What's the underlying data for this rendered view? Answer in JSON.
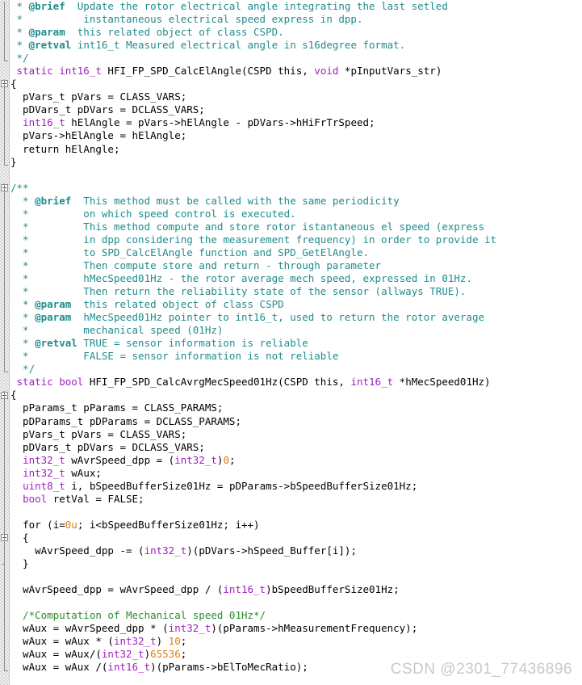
{
  "editor": {
    "language": "c",
    "watermark": "CSDN @2301_77436896",
    "colors": {
      "background": "#ffffff",
      "comment": "#1f8c8c",
      "plain_comment": "#2e8b2e",
      "keyword": "#1111cc",
      "type": "#a020c0",
      "number": "#d98018",
      "text": "#000000",
      "gutter": "#f0f0f0",
      "watermark": "#c9c9c9"
    }
  },
  "code_lines": [
    {
      "gutter": "line",
      "tokens": [
        {
          "t": "cmt",
          "s": " * "
        },
        {
          "t": "cmtb",
          "s": "@brief"
        },
        {
          "t": "cmt",
          "s": "  Update the rotor electrical angle integrating the last setled"
        }
      ]
    },
    {
      "gutter": "line",
      "tokens": [
        {
          "t": "cmt",
          "s": " *          instantaneous electrical speed express in dpp."
        }
      ]
    },
    {
      "gutter": "line",
      "tokens": [
        {
          "t": "cmt",
          "s": " * "
        },
        {
          "t": "cmtb",
          "s": "@param"
        },
        {
          "t": "cmt",
          "s": "  this related object of class CSPD."
        }
      ]
    },
    {
      "gutter": "line",
      "tokens": [
        {
          "t": "cmt",
          "s": " * "
        },
        {
          "t": "cmtb",
          "s": "@retval"
        },
        {
          "t": "cmt",
          "s": " int16_t Measured electrical angle in s16degree format."
        }
      ]
    },
    {
      "gutter": "line-end",
      "tokens": [
        {
          "t": "cmt",
          "s": " */"
        }
      ]
    },
    {
      "gutter": "none",
      "tokens": [
        {
          "t": "typ",
          "s": " static int16_t"
        },
        {
          "t": "pln",
          "s": " HFI_FP_SPD_CalcElAngle(CSPD this, "
        },
        {
          "t": "typ",
          "s": "void"
        },
        {
          "t": "pln",
          "s": " *pInputVars_str)"
        }
      ]
    },
    {
      "gutter": "box-start",
      "tokens": [
        {
          "t": "pln",
          "s": "{"
        }
      ]
    },
    {
      "gutter": "line",
      "tokens": [
        {
          "t": "pln",
          "s": "  pVars_t pVars = CLASS_VARS;"
        }
      ]
    },
    {
      "gutter": "line",
      "tokens": [
        {
          "t": "pln",
          "s": "  pDVars_t pDVars = DCLASS_VARS;"
        }
      ]
    },
    {
      "gutter": "line",
      "tokens": [
        {
          "t": "pln",
          "s": "  "
        },
        {
          "t": "typ",
          "s": "int16_t"
        },
        {
          "t": "pln",
          "s": " hElAngle = pVars->hElAngle - pDVars->hHiFrTrSpeed;"
        }
      ]
    },
    {
      "gutter": "line",
      "tokens": [
        {
          "t": "pln",
          "s": "  pVars->hElAngle = hElAngle;"
        }
      ]
    },
    {
      "gutter": "line",
      "tokens": [
        {
          "t": "pln",
          "s": "  "
        },
        {
          "t": "kw",
          "s": "return"
        },
        {
          "t": "pln",
          "s": " hElAngle;"
        }
      ]
    },
    {
      "gutter": "line-end",
      "tokens": [
        {
          "t": "pln",
          "s": "}"
        }
      ]
    },
    {
      "gutter": "none",
      "tokens": [
        {
          "t": "pln",
          "s": ""
        }
      ]
    },
    {
      "gutter": "box-start",
      "tokens": [
        {
          "t": "cmt",
          "s": "/**"
        }
      ]
    },
    {
      "gutter": "line",
      "tokens": [
        {
          "t": "cmt",
          "s": "  * "
        },
        {
          "t": "cmtb",
          "s": "@brief"
        },
        {
          "t": "cmt",
          "s": "  This method must be called with the same periodicity"
        }
      ]
    },
    {
      "gutter": "line",
      "tokens": [
        {
          "t": "cmt",
          "s": "  *         on which speed control is executed."
        }
      ]
    },
    {
      "gutter": "line",
      "tokens": [
        {
          "t": "cmt",
          "s": "  *         This method compute and store rotor istantaneous el speed (express"
        }
      ]
    },
    {
      "gutter": "line",
      "tokens": [
        {
          "t": "cmt",
          "s": "  *         in dpp considering the measurement frequency) in order to provide it"
        }
      ]
    },
    {
      "gutter": "line",
      "tokens": [
        {
          "t": "cmt",
          "s": "  *         to SPD_CalcElAngle function and SPD_GetElAngle."
        }
      ]
    },
    {
      "gutter": "line",
      "tokens": [
        {
          "t": "cmt",
          "s": "  *         Then compute store and return - through parameter"
        }
      ]
    },
    {
      "gutter": "line",
      "tokens": [
        {
          "t": "cmt",
          "s": "  *         hMecSpeed01Hz - the rotor average mech speed, expressed in 01Hz."
        }
      ]
    },
    {
      "gutter": "line",
      "tokens": [
        {
          "t": "cmt",
          "s": "  *         Then return the reliability state of the sensor (allways TRUE)."
        }
      ]
    },
    {
      "gutter": "line",
      "tokens": [
        {
          "t": "cmt",
          "s": "  * "
        },
        {
          "t": "cmtb",
          "s": "@param"
        },
        {
          "t": "cmt",
          "s": "  this related object of class CSPD"
        }
      ]
    },
    {
      "gutter": "line",
      "tokens": [
        {
          "t": "cmt",
          "s": "  * "
        },
        {
          "t": "cmtb",
          "s": "@param"
        },
        {
          "t": "cmt",
          "s": "  hMecSpeed01Hz pointer to int16_t, used to return the rotor average"
        }
      ]
    },
    {
      "gutter": "line",
      "tokens": [
        {
          "t": "cmt",
          "s": "  *         mechanical speed (01Hz)"
        }
      ]
    },
    {
      "gutter": "line",
      "tokens": [
        {
          "t": "cmt",
          "s": "  * "
        },
        {
          "t": "cmtb",
          "s": "@retval"
        },
        {
          "t": "cmt",
          "s": " TRUE = sensor information is reliable"
        }
      ]
    },
    {
      "gutter": "line",
      "tokens": [
        {
          "t": "cmt",
          "s": "  *         FALSE = sensor information is not reliable"
        }
      ]
    },
    {
      "gutter": "line-end",
      "tokens": [
        {
          "t": "cmt",
          "s": "  */"
        }
      ]
    },
    {
      "gutter": "none",
      "tokens": [
        {
          "t": "typ",
          "s": " static bool"
        },
        {
          "t": "pln",
          "s": " HFI_FP_SPD_CalcAvrgMecSpeed01Hz(CSPD this, "
        },
        {
          "t": "typ",
          "s": "int16_t"
        },
        {
          "t": "pln",
          "s": " *hMecSpeed01Hz)"
        }
      ]
    },
    {
      "gutter": "box-start",
      "tokens": [
        {
          "t": "pln",
          "s": "{"
        }
      ]
    },
    {
      "gutter": "line",
      "tokens": [
        {
          "t": "pln",
          "s": "  pParams_t pParams = CLASS_PARAMS;"
        }
      ]
    },
    {
      "gutter": "line",
      "tokens": [
        {
          "t": "pln",
          "s": "  pDParams_t pDParams = DCLASS_PARAMS;"
        }
      ]
    },
    {
      "gutter": "line",
      "tokens": [
        {
          "t": "pln",
          "s": "  pVars_t pVars = CLASS_VARS;"
        }
      ]
    },
    {
      "gutter": "line",
      "tokens": [
        {
          "t": "pln",
          "s": "  pDVars_t pDVars = DCLASS_VARS;"
        }
      ]
    },
    {
      "gutter": "line",
      "tokens": [
        {
          "t": "pln",
          "s": "  "
        },
        {
          "t": "typ",
          "s": "int32_t"
        },
        {
          "t": "pln",
          "s": " wAvrSpeed_dpp = ("
        },
        {
          "t": "typ",
          "s": "int32_t"
        },
        {
          "t": "pln",
          "s": ")"
        },
        {
          "t": "num",
          "s": "0"
        },
        {
          "t": "pln",
          "s": ";"
        }
      ]
    },
    {
      "gutter": "line",
      "tokens": [
        {
          "t": "pln",
          "s": "  "
        },
        {
          "t": "typ",
          "s": "int32_t"
        },
        {
          "t": "pln",
          "s": " wAux;"
        }
      ]
    },
    {
      "gutter": "line",
      "tokens": [
        {
          "t": "pln",
          "s": "  "
        },
        {
          "t": "typ",
          "s": "uint8_t"
        },
        {
          "t": "pln",
          "s": " i, bSpeedBufferSize01Hz = pDParams->bSpeedBufferSize01Hz;"
        }
      ]
    },
    {
      "gutter": "line",
      "tokens": [
        {
          "t": "pln",
          "s": "  "
        },
        {
          "t": "typ",
          "s": "bool"
        },
        {
          "t": "pln",
          "s": " retVal = FALSE;"
        }
      ]
    },
    {
      "gutter": "line",
      "tokens": [
        {
          "t": "pln",
          "s": ""
        }
      ]
    },
    {
      "gutter": "line",
      "tokens": [
        {
          "t": "pln",
          "s": "  "
        },
        {
          "t": "kw",
          "s": "for"
        },
        {
          "t": "pln",
          "s": " (i="
        },
        {
          "t": "num",
          "s": "0u"
        },
        {
          "t": "pln",
          "s": "; i<bSpeedBufferSize01Hz; i++)"
        }
      ]
    },
    {
      "gutter": "box-inner",
      "tokens": [
        {
          "t": "pln",
          "s": "  {"
        }
      ]
    },
    {
      "gutter": "line",
      "tokens": [
        {
          "t": "pln",
          "s": "    wAvrSpeed_dpp -= ("
        },
        {
          "t": "typ",
          "s": "int32_t"
        },
        {
          "t": "pln",
          "s": ")(pDVars->hSpeed_Buffer[i]);"
        }
      ]
    },
    {
      "gutter": "tick",
      "tokens": [
        {
          "t": "pln",
          "s": "  }"
        }
      ]
    },
    {
      "gutter": "line",
      "tokens": [
        {
          "t": "pln",
          "s": ""
        }
      ]
    },
    {
      "gutter": "line",
      "tokens": [
        {
          "t": "pln",
          "s": "  wAvrSpeed_dpp = wAvrSpeed_dpp / ("
        },
        {
          "t": "typ",
          "s": "int16_t"
        },
        {
          "t": "pln",
          "s": ")bSpeedBufferSize01Hz;"
        }
      ]
    },
    {
      "gutter": "line",
      "tokens": [
        {
          "t": "pln",
          "s": ""
        }
      ]
    },
    {
      "gutter": "line",
      "tokens": [
        {
          "t": "gcmt",
          "s": "  /*Computation of Mechanical speed 01Hz*/"
        }
      ]
    },
    {
      "gutter": "line",
      "tokens": [
        {
          "t": "pln",
          "s": "  wAux = wAvrSpeed_dpp * ("
        },
        {
          "t": "typ",
          "s": "int32_t"
        },
        {
          "t": "pln",
          "s": ")(pParams->hMeasurementFrequency);"
        }
      ]
    },
    {
      "gutter": "line",
      "tokens": [
        {
          "t": "pln",
          "s": "  wAux = wAux * ("
        },
        {
          "t": "typ",
          "s": "int32_t"
        },
        {
          "t": "pln",
          "s": ") "
        },
        {
          "t": "num",
          "s": "10"
        },
        {
          "t": "pln",
          "s": ";"
        }
      ]
    },
    {
      "gutter": "line",
      "tokens": [
        {
          "t": "pln",
          "s": "  wAux = wAux/("
        },
        {
          "t": "typ",
          "s": "int32_t"
        },
        {
          "t": "pln",
          "s": ")"
        },
        {
          "t": "num",
          "s": "65536"
        },
        {
          "t": "pln",
          "s": ";"
        }
      ]
    },
    {
      "gutter": "line",
      "tokens": [
        {
          "t": "pln",
          "s": "  wAux = wAux /("
        },
        {
          "t": "typ",
          "s": "int16_t"
        },
        {
          "t": "pln",
          "s": ")(pParams->bElToMecRatio);"
        }
      ]
    }
  ]
}
